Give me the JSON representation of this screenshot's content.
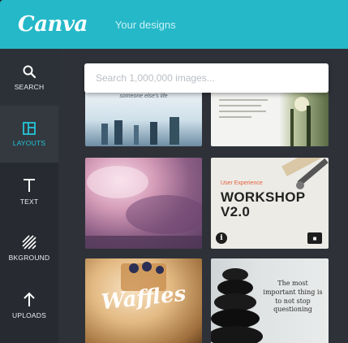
{
  "header": {
    "logo": "Canva",
    "title": "Your designs"
  },
  "sidebar": {
    "items": [
      {
        "label": "Search",
        "icon": "search-icon",
        "active": false
      },
      {
        "label": "Layouts",
        "icon": "layouts-icon",
        "active": true
      },
      {
        "label": "Text",
        "icon": "text-icon",
        "active": false
      },
      {
        "label": "Bkground",
        "icon": "background-icon",
        "active": false
      },
      {
        "label": "Uploads",
        "icon": "upload-icon",
        "active": false
      }
    ]
  },
  "search": {
    "placeholder": "Search 1,000,000 images..."
  },
  "layouts": [
    {
      "title": "someone else's life"
    },
    {
      "title": ""
    },
    {
      "title": ""
    },
    {
      "eyebrow": "User Experience",
      "title": "WORKSHOP V2.0"
    },
    {
      "title": "Waffles"
    },
    {
      "title": "The most important thing is to not stop questioning"
    }
  ],
  "colors": {
    "header": "#25b8c9",
    "sidebar": "#272b31",
    "active": "#25c5d9",
    "main": "#2e3238"
  }
}
